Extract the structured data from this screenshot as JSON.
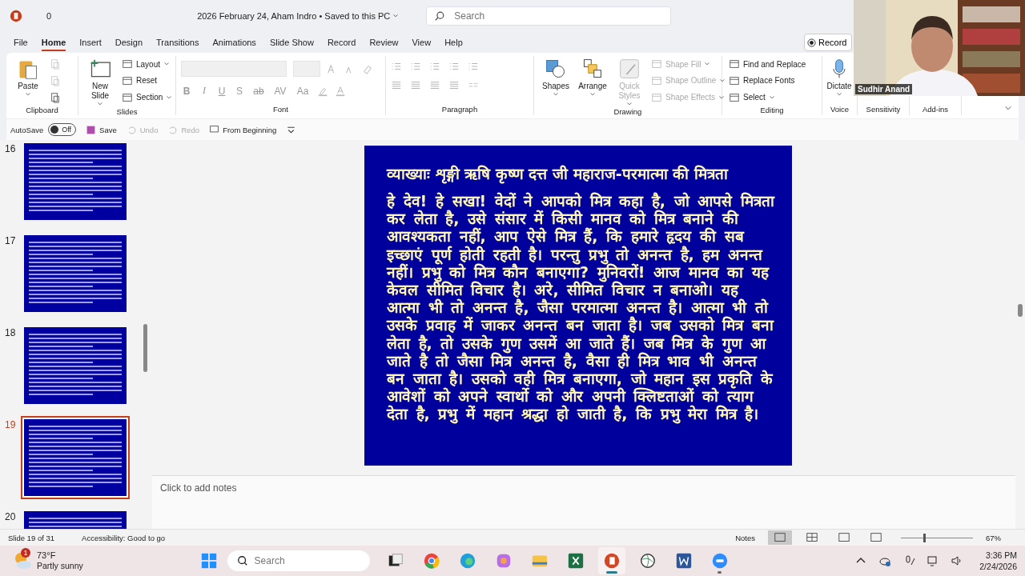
{
  "title_bar": {
    "autosave_count": "0",
    "document_title": "2026  February 24,  Aham Indro • Saved to this PC",
    "search": {
      "placeholder": "Search"
    }
  },
  "menu_tabs": [
    {
      "label": "File",
      "selected": false
    },
    {
      "label": "Home",
      "selected": true
    },
    {
      "label": "Insert",
      "selected": false
    },
    {
      "label": "Design",
      "selected": false
    },
    {
      "label": "Transitions",
      "selected": false
    },
    {
      "label": "Animations",
      "selected": false
    },
    {
      "label": "Slide Show",
      "selected": false
    },
    {
      "label": "Record",
      "selected": false
    },
    {
      "label": "Review",
      "selected": false
    },
    {
      "label": "View",
      "selected": false
    },
    {
      "label": "Help",
      "selected": false
    }
  ],
  "record_button": "Record",
  "ribbon": [
    {
      "kind": "clipboard",
      "label": "Clipboard",
      "items": [
        {
          "kind": "large",
          "label": "Paste",
          "disabled": false,
          "dropdown": true
        },
        {
          "kind": "icon",
          "disabled": true
        },
        {
          "kind": "icon",
          "disabled": true
        },
        {
          "kind": "icon",
          "disabled": false
        }
      ]
    },
    {
      "kind": "slides",
      "label": "Slides",
      "items": [
        {
          "kind": "large",
          "label": "New Slide",
          "disabled": false,
          "dropdown": true
        },
        {
          "kind": "small",
          "label": "Layout",
          "disabled": false,
          "dropdown": true
        },
        {
          "kind": "small",
          "label": "Reset",
          "disabled": false,
          "dropdown": false
        },
        {
          "kind": "small",
          "label": "Section",
          "disabled": false,
          "dropdown": true
        }
      ]
    },
    {
      "kind": "font",
      "label": "Font",
      "tools": [
        "B",
        "I",
        "U",
        "S",
        "ab",
        "AV",
        "Aa"
      ]
    },
    {
      "kind": "paragraph",
      "label": "Paragraph"
    },
    {
      "kind": "drawing",
      "label": "Drawing",
      "items": [
        {
          "kind": "large",
          "label": "Shapes",
          "disabled": false,
          "dropdown": true
        },
        {
          "kind": "large",
          "label": "Arrange",
          "disabled": false,
          "dropdown": true
        },
        {
          "kind": "large",
          "label": "Quick Styles",
          "disabled": true,
          "dropdown": true
        },
        {
          "kind": "small",
          "label": "Shape Fill",
          "disabled": true,
          "dropdown": true
        },
        {
          "kind": "small",
          "label": "Shape Outline",
          "disabled": true,
          "dropdown": true
        },
        {
          "kind": "small",
          "label": "Shape Effects",
          "disabled": true,
          "dropdown": true
        }
      ]
    },
    {
      "kind": "editing",
      "label": "Editing",
      "items": [
        {
          "kind": "small",
          "label": "Find and Replace",
          "disabled": false,
          "dropdown": false
        },
        {
          "kind": "small",
          "label": "Replace Fonts",
          "disabled": false,
          "dropdown": false
        },
        {
          "kind": "small",
          "label": "Select",
          "disabled": false,
          "dropdown": true
        }
      ]
    },
    {
      "kind": "voice",
      "label": "Voice",
      "items": [
        {
          "kind": "large",
          "label": "Dictate",
          "disabled": false,
          "dropdown": true
        }
      ]
    },
    {
      "kind": "empty",
      "label": "Sensitivity"
    },
    {
      "kind": "empty",
      "label": "Add-ins"
    }
  ],
  "quick_access": {
    "autosave_label": "AutoSave",
    "autosave": {
      "on": false,
      "label": "Off"
    },
    "items": [
      {
        "label": "Save",
        "disabled": false
      },
      {
        "label": "Undo",
        "disabled": true
      },
      {
        "label": "Redo",
        "disabled": true
      },
      {
        "label": "From Beginning",
        "disabled": false
      }
    ]
  },
  "thumbnails": [
    {
      "number": "16",
      "selected": false
    },
    {
      "number": "17",
      "selected": false
    },
    {
      "number": "18",
      "selected": false
    },
    {
      "number": "19",
      "selected": true
    },
    {
      "number": "20",
      "selected": false
    }
  ],
  "slide": {
    "heading": "व्याख्याः शृङ्गी ऋषि कृष्ण दत्त जी महाराज-परमात्मा की मित्रता",
    "body": "हे देव! हे सखा! वेदों ने आपको मित्र कहा है, जो आपसे मित्रता कर लेता है, उसे संसार में किसी मानव को मित्र बनाने की आवश्यकता नहीं, आप ऐसे मित्र हैं, कि हमारे हृदय की सब इच्छाएं पूर्ण होती रहती है। परन्तु प्रभु तो अनन्त है, हम अनन्त नहीं। प्रभु को मित्र कौन बनाएगा? मुनिवरों! आज मानव का यह केवल सीमित विचार है। अरे, सीमित विचार न बनाओ। यह आत्मा भी तो अनन्त है, जैसा परमात्मा अनन्त है। आत्मा भी तो उसके प्रवाह में जाकर अनन्त बन जाता है। जब उसको मित्र बना लेता है, तो उसके गुण उसमें आ जाते हैं। जब मित्र के गुण आ जाते है तो जैसा मित्र अनन्त है, वैसा ही मित्र भाव भी अनन्त बन जाता है। उसको वही मित्र बनाएगा, जो महान इस प्रकृति के आवेशों को अपने स्वार्थो को और अपनी क्लिष्टताओं को त्याग देता है, प्रभु में महान श्रद्धा हो जाती है, कि प्रभु मेरा मित्र है।"
  },
  "notes_placeholder": "Click to add notes",
  "status_bar": {
    "slide_info": "Slide 19 of 31",
    "accessibility": "Accessibility: Good to go",
    "notes": "Notes",
    "views": [
      {
        "selected": true
      },
      {
        "selected": false
      },
      {
        "selected": false
      },
      {
        "selected": false
      }
    ],
    "zoom": {
      "level": 0.32,
      "reading": "67%"
    }
  },
  "taskbar": {
    "weather": {
      "badge": "1",
      "temperature": "73°F",
      "condition": "Partly sunny"
    },
    "search": {
      "placeholder": "Search"
    },
    "apps": [
      {
        "kind": "taskview",
        "selected": false,
        "running": false
      },
      {
        "kind": "chrome",
        "selected": false,
        "running": false
      },
      {
        "kind": "edge",
        "selected": false,
        "running": false
      },
      {
        "kind": "copilot",
        "selected": false,
        "running": false
      },
      {
        "kind": "explorer",
        "selected": false,
        "running": false
      },
      {
        "kind": "excel",
        "selected": false,
        "running": false
      },
      {
        "kind": "powerpoint",
        "selected": true,
        "running": true
      },
      {
        "kind": "globe",
        "selected": false,
        "running": false
      },
      {
        "kind": "word",
        "selected": false,
        "running": false
      },
      {
        "kind": "zoom",
        "selected": false,
        "running": true
      }
    ],
    "clock": {
      "time": "3:36 PM",
      "date": "2/24/2026"
    }
  },
  "webcam": {
    "kind": "picture",
    "name": "Sudhir Anand"
  }
}
